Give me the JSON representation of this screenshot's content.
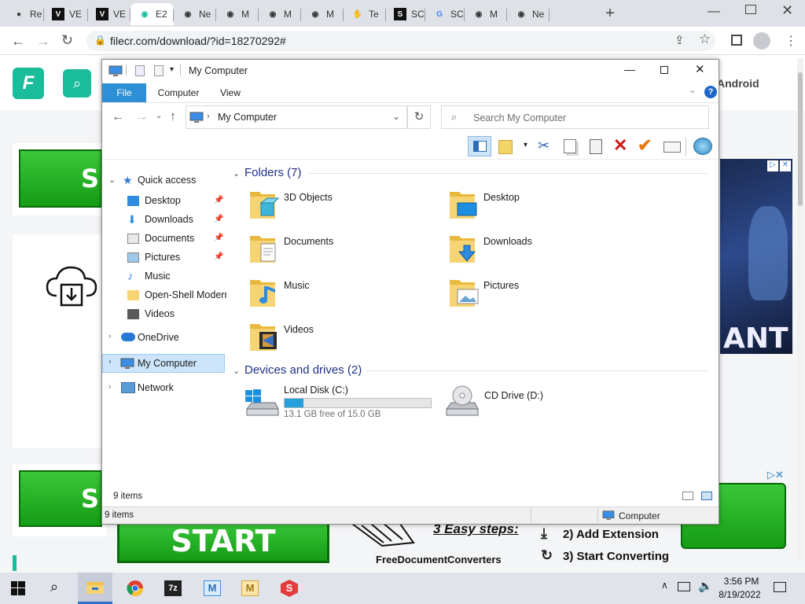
{
  "browser": {
    "tabs": [
      {
        "label": "Re",
        "icon": "github-icon",
        "fav": "●"
      },
      {
        "label": "VE",
        "icon": "v-icon",
        "fav": "V"
      },
      {
        "label": "VE",
        "icon": "v-icon",
        "fav": "V"
      },
      {
        "label": "E2",
        "icon": "chrome-globe-icon",
        "fav": "◉"
      },
      {
        "label": "Ne",
        "icon": "globe-icon",
        "fav": "◉"
      },
      {
        "label": "M",
        "icon": "globe-icon",
        "fav": "◉"
      },
      {
        "label": "M",
        "icon": "globe-icon",
        "fav": "◉"
      },
      {
        "label": "M",
        "icon": "globe-icon",
        "fav": "◉"
      },
      {
        "label": "Te",
        "icon": "hand-icon",
        "fav": "✋"
      },
      {
        "label": "SC",
        "icon": "s-icon",
        "fav": "S"
      },
      {
        "label": "SC",
        "icon": "google-icon",
        "fav": "G"
      },
      {
        "label": "M",
        "icon": "globe-icon",
        "fav": "◉"
      },
      {
        "label": "Ne",
        "icon": "globe-icon",
        "fav": "◉"
      }
    ],
    "url": "filecr.com/download/?id=18270292#",
    "colors": {
      "tabbar": "#dee1e6",
      "accent": "#1abc9c"
    }
  },
  "website": {
    "android_label": "Android",
    "start_label": "START",
    "three_steps": "3 Easy steps:",
    "step2": "2) Add Extension",
    "step3": "3) Start Converting",
    "brand": "FreeDocumentConverters",
    "ad_text": "ANT"
  },
  "explorer": {
    "title": "My Computer",
    "ribbon_tabs": [
      "File",
      "Computer",
      "View"
    ],
    "address": "My Computer",
    "search_placeholder": "Search My Computer",
    "nav": {
      "quick_access": "Quick access",
      "items": [
        {
          "label": "Desktop",
          "pinned": true,
          "icon": "desktop-icon"
        },
        {
          "label": "Downloads",
          "pinned": true,
          "icon": "download-icon"
        },
        {
          "label": "Documents",
          "pinned": true,
          "icon": "document-icon"
        },
        {
          "label": "Pictures",
          "pinned": true,
          "icon": "picture-icon"
        },
        {
          "label": "Music",
          "pinned": false,
          "icon": "music-icon"
        },
        {
          "label": "Open-Shell Modern",
          "pinned": false,
          "icon": "folder-icon"
        },
        {
          "label": "Videos",
          "pinned": false,
          "icon": "video-icon"
        }
      ],
      "onedrive": "OneDrive",
      "my_computer": "My Computer",
      "network": "Network"
    },
    "folders_header": "Folders (7)",
    "folders": [
      {
        "label": "3D Objects",
        "overlay": "cube"
      },
      {
        "label": "Desktop",
        "overlay": "monitor"
      },
      {
        "label": "Documents",
        "overlay": "doc"
      },
      {
        "label": "Downloads",
        "overlay": "arrow"
      },
      {
        "label": "Music",
        "overlay": "note"
      },
      {
        "label": "Pictures",
        "overlay": "photo"
      },
      {
        "label": "Videos",
        "overlay": "film"
      }
    ],
    "devices_header": "Devices and drives (2)",
    "drives": [
      {
        "label": "Local Disk (C:)",
        "free_text": "13.1 GB free of 15.0 GB",
        "used_fraction": 0.127
      },
      {
        "label": "CD Drive (D:)"
      }
    ],
    "status_items": "9 items",
    "status_bottom_items": "9 items",
    "status_location": "Computer"
  },
  "taskbar": {
    "time": "3:56 PM",
    "date": "8/19/2022",
    "apps": [
      "file-explorer-icon",
      "chrome-icon",
      "7zip-icon",
      "mail-icon",
      "mail-yellow-icon",
      "s-app-icon"
    ],
    "app_labels": {
      "sevenzip": "7z",
      "mail": "M",
      "mail2": "M",
      "sapp": "S"
    }
  }
}
